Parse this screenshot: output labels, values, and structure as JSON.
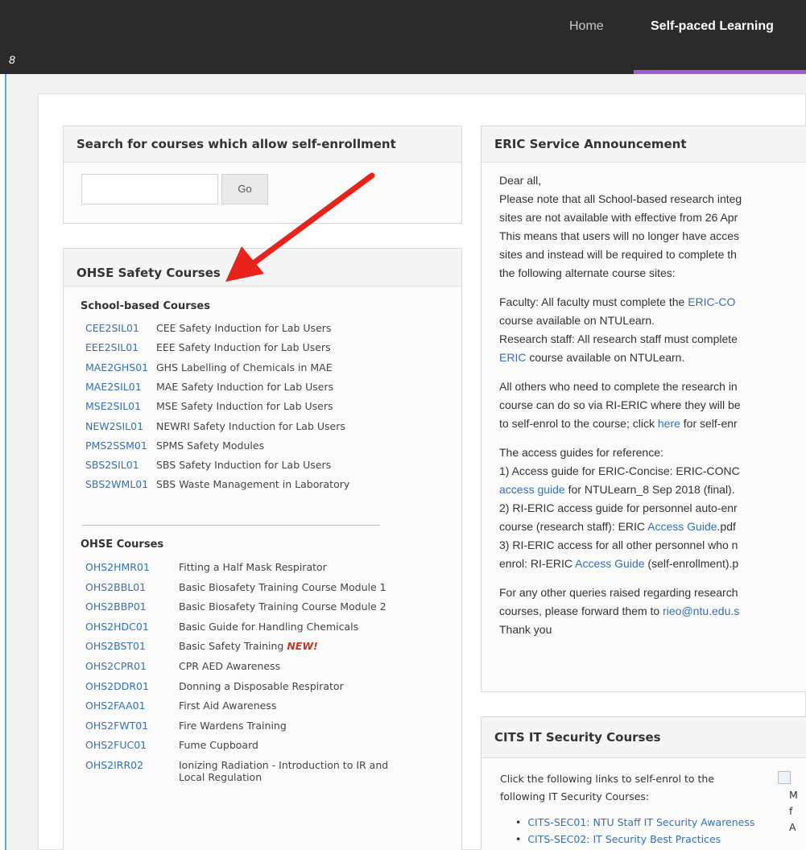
{
  "nav": {
    "home": "Home",
    "self_paced": "Self-paced Learning"
  },
  "colors": {
    "accent_bar": "#a35bd8",
    "link": "#3570b7",
    "topbar": "#2b2b2b"
  },
  "search_panel": {
    "title": "Search for courses which allow self-enrollment",
    "input_value": "",
    "go_label": "Go"
  },
  "ohse_panel": {
    "title": "OHSE Safety Courses",
    "school_title": "School-based Courses",
    "school_courses": [
      {
        "code": "CEE2SIL01",
        "name": "CEE Safety Induction for Lab Users"
      },
      {
        "code": "EEE2SIL01",
        "name": "EEE Safety Induction for Lab Users"
      },
      {
        "code": "MAE2GHS01",
        "name": "GHS Labelling of Chemicals in MAE"
      },
      {
        "code": "MAE2SIL01",
        "name": "MAE Safety Induction for Lab Users"
      },
      {
        "code": "MSE2SIL01",
        "name": "MSE Safety Induction for Lab Users"
      },
      {
        "code": "NEW2SIL01",
        "name": "NEWRI Safety Induction for Lab Users"
      },
      {
        "code": "PMS2SSM01",
        "name": "SPMS Safety Modules"
      },
      {
        "code": "SBS2SIL01",
        "name": "SBS Safety Induction for Lab Users"
      },
      {
        "code": "SBS2WML01",
        "name": "SBS Waste Management in Laboratory"
      }
    ],
    "ohse_title": "OHSE Courses",
    "ohse_courses": [
      {
        "code": "OHS2HMR01",
        "name": "Fitting a Half Mask Respirator"
      },
      {
        "code": "OHS2BBL01",
        "name": "Basic Biosafety Training Course Module 1"
      },
      {
        "code": "OHS2BBP01",
        "name": "Basic Biosafety Training Course Module 2"
      },
      {
        "code": "OHS2HDC01",
        "name": "Basic Guide for Handling Chemicals"
      },
      {
        "code": "OHS2BST01",
        "name": "Basic Safety Training",
        "badge": "NEW!"
      },
      {
        "code": "OHS2CPR01",
        "name": "CPR AED Awareness"
      },
      {
        "code": "OHS2DDR01",
        "name": "Donning a Disposable Respirator"
      },
      {
        "code": "OHS2FAA01",
        "name": "First Aid Awareness"
      },
      {
        "code": "OHS2FWT01",
        "name": "Fire Wardens Training"
      },
      {
        "code": "OHS2FUC01",
        "name": "Fume Cupboard"
      },
      {
        "code": "OHS2IRR02",
        "name": "Ionizing Radiation - Introduction to IR and",
        "name2": "Local Regulation"
      }
    ]
  },
  "eric_panel": {
    "title": "ERIC Service Announcement",
    "greeting": "Dear all,",
    "p1_l1": "Please note that all School-based research integ",
    "p1_l2": "sites are not available with effective from 26 Apr",
    "p1_l3": "This means that users will no longer have acces",
    "p1_l4": "sites and instead will be required to complete th",
    "p1_l5": "the following alternate course sites:",
    "fac_a": "Faculty: All faculty must complete the ",
    "fac_link": "ERIC-CO",
    "fac_b": "course available on NTULearn.",
    "rs_a": "Research staff: All research staff must complete",
    "rs_link": "ERIC",
    "rs_b": " course available on NTULearn.",
    "oth_l1": "All others who need to complete the research in",
    "oth_l2": "course can do so via RI-ERIC where they will be",
    "oth_l3a": "to self-enrol to the course; click ",
    "oth_link": "here",
    "oth_l3b": " for self-enr",
    "guides_head": "The access guides for reference:",
    "g1_a": "1) Access guide for ERIC-Concise: ERIC-CONC",
    "g1_link": "access guide",
    "g1_b": " for NTULearn_8 Sep 2018 (final).",
    "g2_a": "2) RI-ERIC access guide for personnel auto-enr",
    "g2_b1": "course (research staff): ERIC ",
    "g2_link": "Access Guide",
    "g2_b2": ".pdf",
    "g3_a": "3) RI-ERIC access for all other personnel who n",
    "g3_b1": "enrol: RI-ERIC ",
    "g3_link": "Access Guide",
    "g3_b2": " (self-enrollment).p",
    "q_l1": "For any other queries raised regarding research",
    "q_l2a": "courses, please forward them to ",
    "q_link": "rieo@ntu.edu.s",
    "thanks": "Thank you"
  },
  "cits_panel": {
    "title": "CITS IT Security Courses",
    "intro_l1": "Click the following links to self-enrol to the",
    "intro_l2": "following IT Security Courses:",
    "links": [
      "CITS-SEC01: NTU Staff IT Security Awareness",
      "CITS-SEC02: IT Security Best Practices"
    ],
    "side_l1": "M",
    "side_l2": "f",
    "side_l3": "A"
  },
  "corner_icon": "8"
}
